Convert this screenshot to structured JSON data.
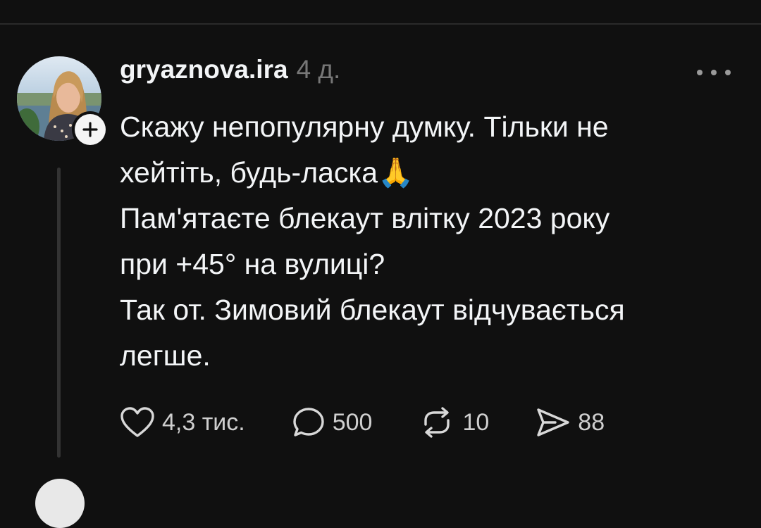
{
  "post": {
    "username": "gryaznova.ira",
    "timestamp": "4 д.",
    "text": "Скажу непопулярну думку. Тільки не\nхейтіть, будь-ласка🙏\nПам'ятаєте блекаут влітку 2023 року\nпри +45° на вулиці?\nТак от. Зимовий блекаут відчувається\nлегше."
  },
  "actions": {
    "likes": "4,3 тис.",
    "comments": "500",
    "reposts": "10",
    "shares": "88"
  },
  "icons": {
    "more": "more-horizontal-icon",
    "like": "heart-icon",
    "comment": "comment-bubble-icon",
    "repost": "repost-icon",
    "share": "send-icon",
    "follow": "plus-icon"
  },
  "colors": {
    "background": "#101010",
    "text": "#f3f5f7",
    "muted": "#777777",
    "divider": "#2a2a2a"
  }
}
